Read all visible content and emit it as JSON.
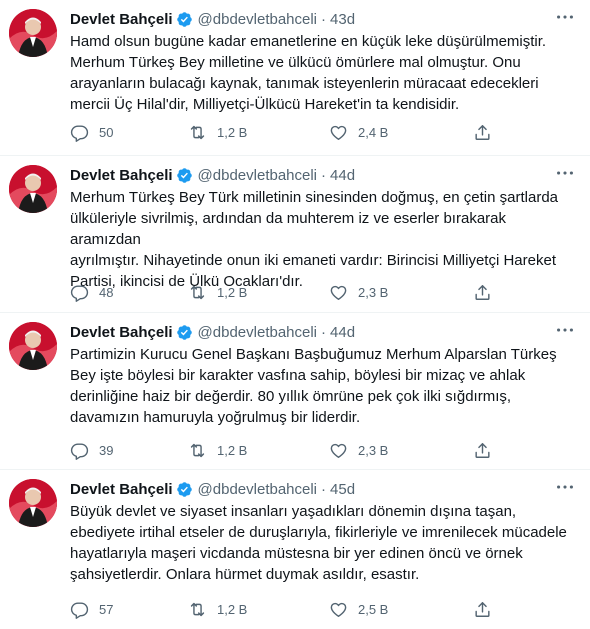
{
  "tweets": [
    {
      "name": "Devlet Bahçeli",
      "handle": "@dbdevletbahceli",
      "separator": "·",
      "time": "43d",
      "lines": [
        "Hamd olsun bugüne kadar emanetlerine en küçük leke düşürülmemiştir.",
        "Merhum Türkeş Bey milletine ve ülkücü ömürlere mal olmuştur. Onu",
        "arayanların bulacağı kaynak, tanımak isteyenlerin müracaat edecekleri",
        "mercii Üç Hilal'dir, Milliyetçi-Ülkücü Hareket'in ta kendisidir."
      ],
      "replies": "50",
      "retweets": "1,2 B",
      "likes": "2,4 B"
    },
    {
      "name": "Devlet Bahçeli",
      "handle": "@dbdevletbahceli",
      "separator": "·",
      "time": "44d",
      "lines": [
        "Merhum Türkeş Bey Türk milletinin sinesinden doğmuş, en çetin şartlarda",
        "ülküleriyle sivrilmiş, ardından da muhterem iz ve eserler bırakarak aramızdan",
        "ayrılmıştır. Nihayetinde onun iki emaneti vardır: Birincisi Milliyetçi Hareket",
        "Partisi, ikincisi de Ülkü Ocakları'dır."
      ],
      "replies": "48",
      "retweets": "1,2 B",
      "likes": "2,3 B"
    },
    {
      "name": "Devlet Bahçeli",
      "handle": "@dbdevletbahceli",
      "separator": "·",
      "time": "44d",
      "lines": [
        "Partimizin Kurucu Genel Başkanı Başbuğumuz Merhum Alparslan Türkeş",
        "Bey işte böylesi bir karakter vasfına sahip, böylesi bir mizaç ve ahlak",
        "derinliğine haiz bir değerdir. 80 yıllık ömrüne pek çok ilki sığdırmış,",
        "davamızın hamuruyla yoğrulmuş bir liderdir."
      ],
      "replies": "39",
      "retweets": "1,2 B",
      "likes": "2,3 B"
    },
    {
      "name": "Devlet Bahçeli",
      "handle": "@dbdevletbahceli",
      "separator": "·",
      "time": "45d",
      "lines": [
        "Büyük devlet ve siyaset insanları yaşadıkları dönemin dışına taşan,",
        "ebediyete irtihal etseler de duruşlarıyla, fikirleriyle ve imrenilecek mücadele",
        "hayatlarıyla maşeri vicdanda müstesna bir yer edinen öncü ve örnek",
        "şahsiyetlerdir. Onlara hürmet duymak asıldır, esastır."
      ],
      "replies": "57",
      "retweets": "1,2 B",
      "likes": "2,5 B"
    }
  ],
  "icons": {
    "verified": "verified-badge-icon",
    "more": "more-options-icon",
    "reply": "reply-icon",
    "retweet": "retweet-icon",
    "like": "heart-icon",
    "share": "share-icon"
  },
  "colors": {
    "text": "#0f1419",
    "secondary": "#536471",
    "verified": "#1d9bf0",
    "divider": "#eff3f4",
    "avatar_background": "#c8102e"
  }
}
